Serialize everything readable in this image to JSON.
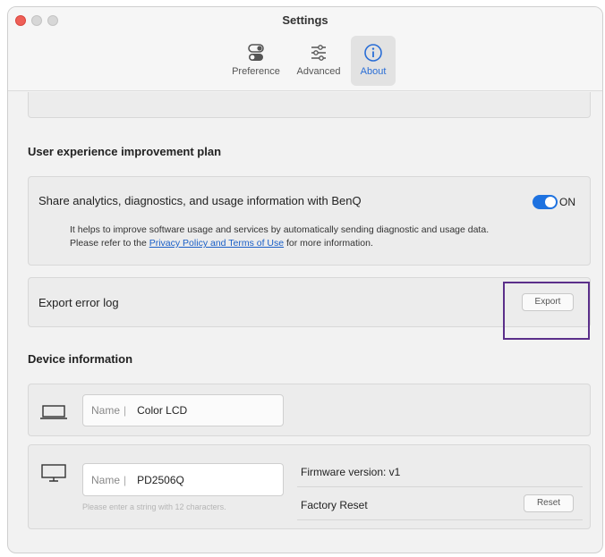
{
  "window": {
    "title": "Settings"
  },
  "toolbar": {
    "preference": "Preference",
    "advanced": "Advanced",
    "about": "About",
    "active_tab": "About"
  },
  "ux_plan": {
    "section_title": "User experience improvement plan",
    "share_label": "Share analytics, diagnostics, and usage information with BenQ",
    "toggle_state": "ON",
    "desc_line1": "It helps to improve software usage and services by automatically sending diagnostic and usage data.",
    "desc_line2_prefix": "Please refer to the ",
    "privacy_link": "Privacy Policy and Terms of Use",
    "desc_line2_suffix": " for more information."
  },
  "export": {
    "label": "Export error log",
    "button": "Export"
  },
  "device": {
    "section_title": "Device information",
    "laptop": {
      "name_label": "Name",
      "name_value": "Color LCD"
    },
    "monitor": {
      "name_label": "Name",
      "name_value": "PD2506Q",
      "hint": "Please enter a string with 12 characters.",
      "firmware": "Firmware version: v1",
      "factory_reset": "Factory Reset",
      "reset_button": "Reset"
    }
  },
  "colors": {
    "accent": "#1e72e0",
    "link": "#1a5fc7",
    "highlight": "#5b2f8a",
    "close": "#ee5f57"
  },
  "icons": [
    "toggle-switch-icon",
    "sliders-icon",
    "info-circle-icon",
    "laptop-icon",
    "monitor-icon"
  ]
}
